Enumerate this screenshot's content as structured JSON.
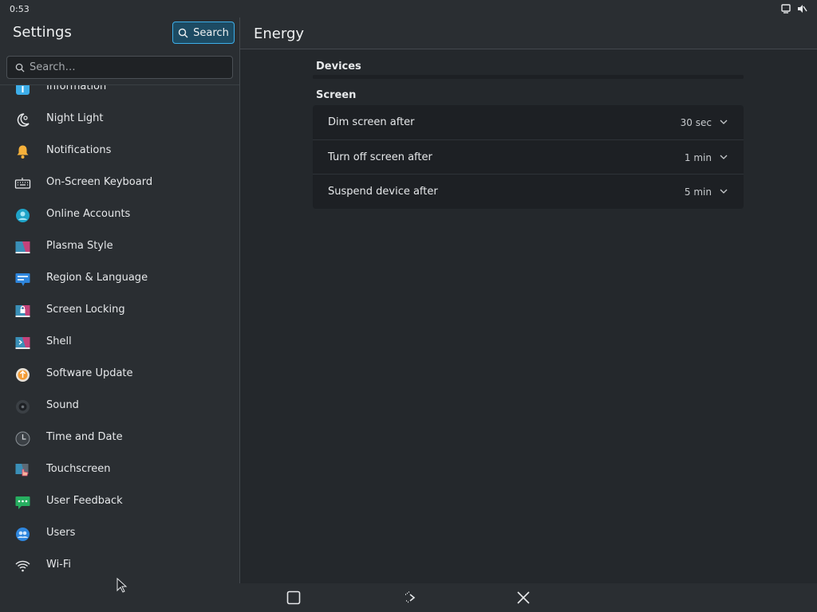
{
  "status": {
    "time": "0:53"
  },
  "sidebar": {
    "title": "Settings",
    "search_button": "Search",
    "search_placeholder": "Search…",
    "items": [
      {
        "label": "Information",
        "icon": "info-icon"
      },
      {
        "label": "Night Light",
        "icon": "night-light-icon"
      },
      {
        "label": "Notifications",
        "icon": "bell-icon"
      },
      {
        "label": "On-Screen Keyboard",
        "icon": "keyboard-icon"
      },
      {
        "label": "Online Accounts",
        "icon": "online-accounts-icon"
      },
      {
        "label": "Plasma Style",
        "icon": "plasma-style-icon"
      },
      {
        "label": "Region & Language",
        "icon": "region-language-icon"
      },
      {
        "label": "Screen Locking",
        "icon": "screen-lock-icon"
      },
      {
        "label": "Shell",
        "icon": "shell-icon"
      },
      {
        "label": "Software Update",
        "icon": "software-update-icon"
      },
      {
        "label": "Sound",
        "icon": "sound-icon"
      },
      {
        "label": "Time and Date",
        "icon": "clock-icon"
      },
      {
        "label": "Touchscreen",
        "icon": "touchscreen-icon"
      },
      {
        "label": "User Feedback",
        "icon": "user-feedback-icon"
      },
      {
        "label": "Users",
        "icon": "users-icon"
      },
      {
        "label": "Wi-Fi",
        "icon": "wifi-icon"
      }
    ]
  },
  "page": {
    "title": "Energy",
    "devices_header": "Devices",
    "screen_header": "Screen",
    "rows": [
      {
        "label": "Dim screen after",
        "value": "30 sec"
      },
      {
        "label": "Turn off screen after",
        "value": "1 min"
      },
      {
        "label": "Suspend device after",
        "value": "5 min"
      }
    ]
  },
  "colors": {
    "accent": "#3daee9",
    "background": "#2a2e32",
    "card": "#1d2024"
  }
}
